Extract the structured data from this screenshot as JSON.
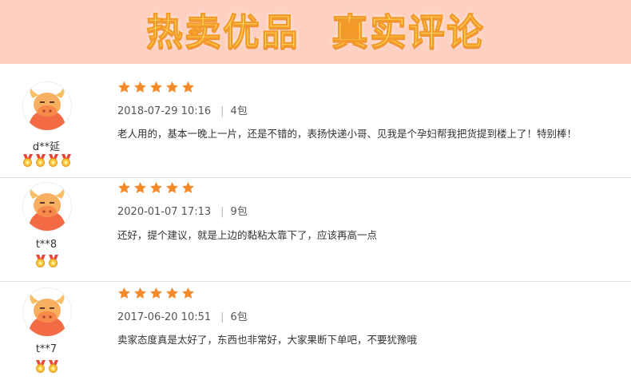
{
  "header": {
    "title_left": "热卖优品",
    "title_right": "真实评论",
    "background": "#fdd0c1"
  },
  "reviews": [
    {
      "username": "d**延",
      "medal_count": 4,
      "rating": 5,
      "date": "2018-07-29 10:16",
      "variant": "4包",
      "text": "老人用的，基本一晚上一片，还是不错的，表扬快递小哥、见我是个孕妇帮我把货提到楼上了！特别棒！"
    },
    {
      "username": "t**8",
      "medal_count": 2,
      "rating": 5,
      "date": "2020-01-07 17:13",
      "variant": "9包",
      "text": "还好，提个建议，就是上边的黏粘太靠下了，应该再高一点"
    },
    {
      "username": "t**7",
      "medal_count": 2,
      "rating": 5,
      "date": "2017-06-20 10:51",
      "variant": "6包",
      "text": "卖家态度真是太好了，东西也非常好，大家果断下单吧，不要犹豫哦"
    }
  ],
  "icons": {
    "avatar": "bull-avatar-icon",
    "rating": "star-icon",
    "medal": "medal-icon"
  },
  "colors": {
    "star": "#f58a2b",
    "avatar_body": "#f26b45",
    "horn": "#f7c067"
  }
}
